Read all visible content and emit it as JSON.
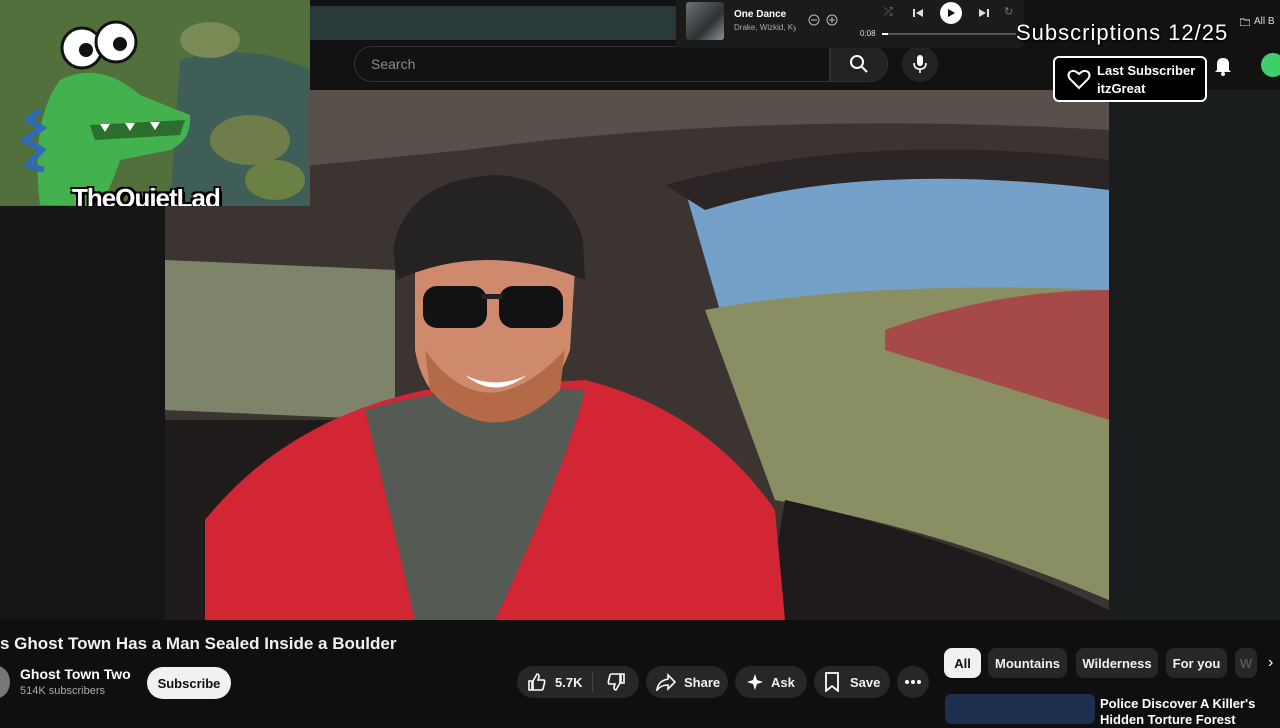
{
  "search": {
    "placeholder": "Search"
  },
  "music": {
    "song": "One Dance",
    "artist": "Drake, Wizkid, Kyla",
    "time": "0:08"
  },
  "header_right": {
    "all_label": "All B"
  },
  "overlay": {
    "subscriptions": "Subscriptions 12/25",
    "last_subscriber_title": "Last Subscriber",
    "last_subscriber_name": "itzGreat"
  },
  "webcam": {
    "brand": "TheQuietLad"
  },
  "video": {
    "title": "s Ghost Town Has a Man Sealed Inside a Boulder",
    "channel": "Ghost Town Two",
    "subscribers": "514K subscribers",
    "subscribe_label": "Subscribe",
    "likes": "5.7K",
    "share_label": "Share",
    "ask_label": "Ask",
    "save_label": "Save"
  },
  "chips": [
    "All",
    "Mountains",
    "Wilderness",
    "For you",
    "W"
  ],
  "recommendation": {
    "title": "Police Discover A Killer's Hidden Torture Forest"
  },
  "colors": {
    "background": "#0f0f0f",
    "chip_active": "#f1f1f1",
    "button": "#272727",
    "accent_green": "#3fcf6a"
  }
}
